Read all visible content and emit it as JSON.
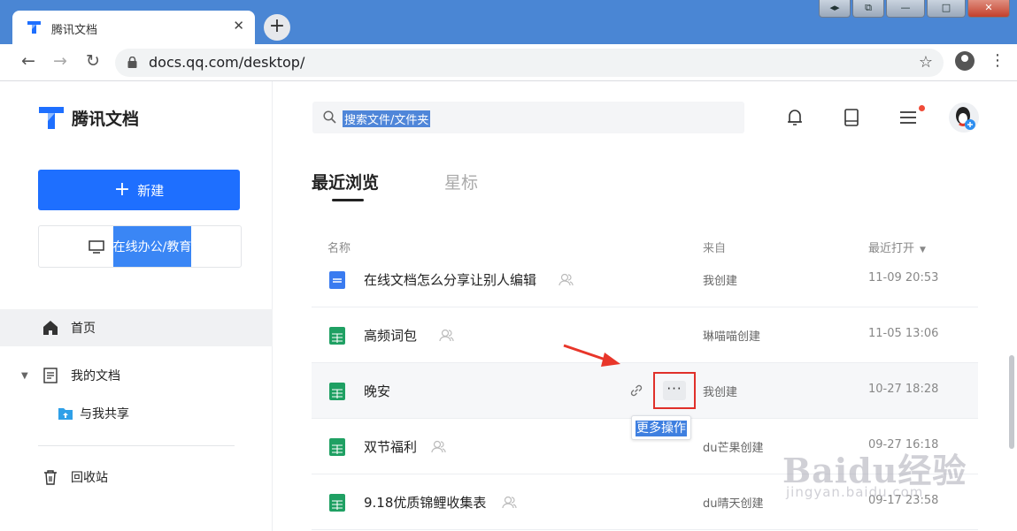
{
  "browser": {
    "tab_title": "腾讯文档",
    "tab_close": "✕",
    "new_tab": "+",
    "url": "docs.qq.com/desktop/",
    "window_controls": [
      "◂▸",
      "⧉",
      "—",
      "□",
      "✕"
    ]
  },
  "sidebar": {
    "brand": "腾讯文档",
    "new_button": "新建",
    "new_button_plus": "+",
    "edu_button": "在线办公/教育",
    "nav": [
      {
        "label": "首页",
        "icon": "home-icon",
        "active": true
      },
      {
        "label": "我的文档",
        "icon": "document-icon",
        "active": false
      },
      {
        "label": "与我共享",
        "icon": "shared-folder-icon",
        "active": false
      },
      {
        "label": "回收站",
        "icon": "trash-icon",
        "active": false
      }
    ]
  },
  "header": {
    "search_placeholder": "搜索文件/文件夹"
  },
  "tabs": {
    "recent": "最近浏览",
    "starred": "星标"
  },
  "columns": {
    "name": "名称",
    "source": "来自",
    "last_opened": "最近打开"
  },
  "files": [
    {
      "name": "在线文档怎么分享让别人编辑",
      "type": "doc",
      "source": "我创建",
      "time": "11-09 20:53"
    },
    {
      "name": "高频词包",
      "type": "sheet",
      "source": "琳喵喵创建",
      "time": "11-05 13:06"
    },
    {
      "name": "晚安",
      "type": "sheet",
      "source": "我创建",
      "time": "10-27 18:28"
    },
    {
      "name": "双节福利",
      "type": "sheet",
      "source": "du芒果创建",
      "time": "09-27 16:18"
    },
    {
      "name": "9.18优质锦鲤收集表",
      "type": "sheet",
      "source": "du晴天创建",
      "time": "09-17 23:58"
    }
  ],
  "row_actions": {
    "more_label": "···",
    "tooltip": "更多操作"
  },
  "watermark": {
    "main": "Baidu经验",
    "sub": "jingyan.baidu.com"
  },
  "colors": {
    "accent": "#1e6fff",
    "tab_strip": "#4a86d4",
    "highlight_box": "#e0302a",
    "sheet_icon": "#1fa063",
    "doc_icon": "#3a7bf0"
  }
}
